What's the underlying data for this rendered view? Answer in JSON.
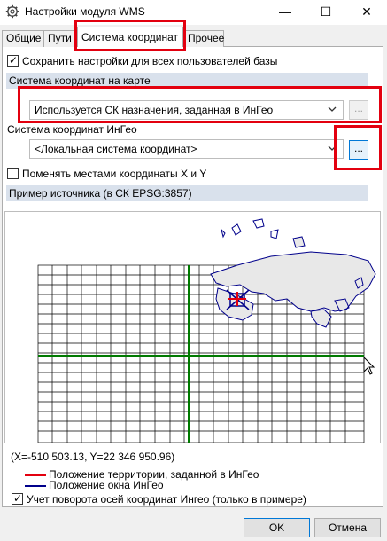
{
  "window": {
    "title": "Настройки модуля WMS",
    "icon": "gear-icon",
    "minimize_glyph": "—",
    "maximize_glyph": "☐",
    "close_glyph": "✕"
  },
  "tabs": [
    {
      "label": "Общие",
      "active": false
    },
    {
      "label": "Пути",
      "active": false
    },
    {
      "label": "Система координат",
      "active": true
    },
    {
      "label": "Прочее",
      "active": false
    }
  ],
  "save_for_all": {
    "label": "Сохранить настройки для всех пользователей базы",
    "checked": true
  },
  "map_cs_section": {
    "title": "Система координат на карте"
  },
  "map_cs_combo": {
    "value": "Используется СК назначения, заданная в ИнГео",
    "button": "..."
  },
  "ingeo_cs": {
    "label": "Система координат ИнГео",
    "combo_value": "<Локальная система координат>",
    "button": "..."
  },
  "swap_xy": {
    "label": "Поменять местами координаты X и Y",
    "checked": false
  },
  "preview_section": {
    "title": "Пример источника (в СК EPSG:3857)"
  },
  "coordinates_readout": "(X=-510 503.13, Y=22 346 950.96)",
  "legend": [
    {
      "label": "Положение территории, заданной в ИнГео",
      "color": "#e3000f"
    },
    {
      "label": "Положение окна ИнГео",
      "color": "#00008b"
    }
  ],
  "rotation": {
    "label": "Учет поворота осей координат Ингео (только в примере)",
    "checked": true
  },
  "buttons": {
    "ok": "OK",
    "cancel": "Отмена"
  },
  "colors": {
    "highlight_box": "#e3000f",
    "section_bg": "#d9e1ec",
    "axis_green": "#007a00",
    "grid": "#000000",
    "map_outline": "#00008b",
    "map_fill": "#e8e8e8"
  }
}
